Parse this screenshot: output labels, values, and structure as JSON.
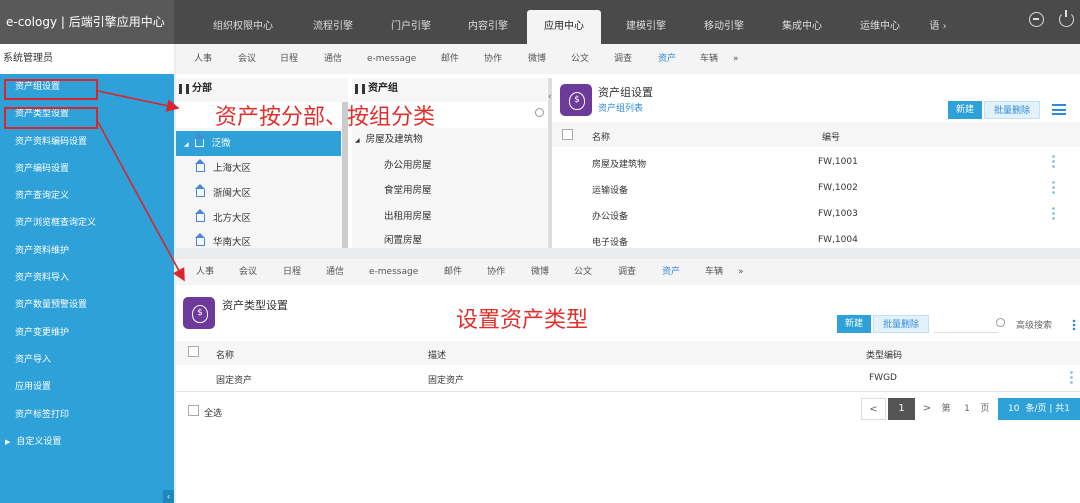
{
  "app_title": "e-cology | 后端引擎应用中心",
  "top_tabs": [
    "组织权限中心",
    "流程引擎",
    "门户引擎",
    "内容引擎",
    "应用中心",
    "建模引擎",
    "移动引擎",
    "集成中心",
    "运维中心",
    "语 ›"
  ],
  "active_top_tab": "应用中心",
  "sidebar": {
    "title": "系统管理员",
    "items": [
      "资产组设置",
      "资产类型设置",
      "资产资料编码设置",
      "资产编码设置",
      "资产查询定义",
      "资产浏览框查询定义",
      "资产资料维护",
      "资产资料导入",
      "资产数量预警设置",
      "资产变更维护",
      "资产导入",
      "应用设置",
      "资产标签打印",
      "自定义设置"
    ]
  },
  "subnav": {
    "items": [
      "人事",
      "会议",
      "日程",
      "通信",
      "e-message",
      "邮件",
      "协作",
      "微博",
      "公文",
      "调查",
      "资产",
      "车辆"
    ],
    "active": "资产",
    "more": "»"
  },
  "branch": {
    "title": "分部",
    "tree": [
      "泛微",
      "上海大区",
      "浙闽大区",
      "北方大区",
      "华南大区"
    ]
  },
  "asset_group_tree": {
    "title": "资产组",
    "items": [
      "房屋及建筑物",
      "办公用房屋",
      "食堂用房屋",
      "出租用房屋",
      "闲置房屋"
    ]
  },
  "asset_group_settings": {
    "title": "资产组设置",
    "link": "资产组列表",
    "new_btn": "新建",
    "del_btn": "批量删除",
    "columns": [
      "名称",
      "编号"
    ],
    "rows": [
      [
        "房屋及建筑物",
        "FW,1001"
      ],
      [
        "运输设备",
        "FW,1002"
      ],
      [
        "办公设备",
        "FW,1003"
      ],
      [
        "电子设备",
        "FW,1004"
      ]
    ]
  },
  "asset_type_settings": {
    "title": "资产类型设置",
    "new_btn": "新建",
    "del_btn": "批量删除",
    "search_label": "高级搜索",
    "columns": [
      "名称",
      "描述",
      "类型编码"
    ],
    "rows": [
      [
        "固定资产",
        "固定资产",
        "FWGD"
      ]
    ],
    "select_all": "全选",
    "pager": {
      "prev": "<",
      "page": "1",
      "next": ">",
      "goto": "第",
      "page_input": "1",
      "page_unit": "页",
      "page_size": "10",
      "page_size_unit": "条/页 | 共1"
    }
  },
  "annotations": {
    "by_branch_group": "资产按分部、按组分类",
    "set_type": "设置资产类型"
  },
  "colors": {
    "accent": "#2ea1d9",
    "annotation": "#e0302c",
    "icon_purple": "#6e3a9a"
  }
}
